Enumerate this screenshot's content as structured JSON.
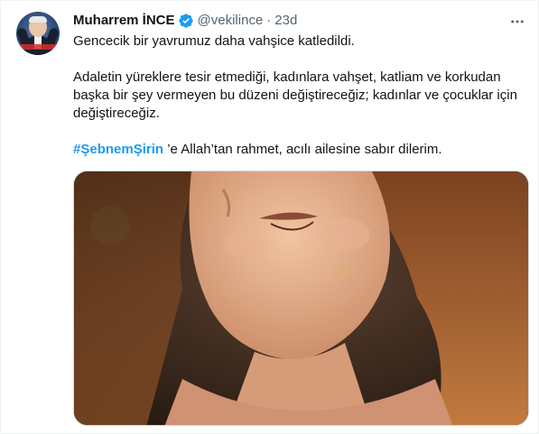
{
  "tweet": {
    "author_name": "Muharrem İNCE",
    "handle": "@vekilince",
    "separator": "·",
    "time": "23d",
    "verified_icon": "verified-badge-icon",
    "more_icon": "more-horizontal-icon",
    "paragraph_1": "Gencecik bir yavrumuz daha vahşice katledildi.",
    "paragraph_2": "Adaletin yüreklere tesir etmediği, kadınlara vahşet, katliam ve korkudan başka bir şey vermeyen bu düzeni değiştireceğiz; kadınlar ve çocuklar için değiştireceğiz.",
    "hashtag": "#ŞebnemŞirin",
    "paragraph_3_rest": " ’e Allah’tan rahmet, acılı ailesine sabır dilerim.",
    "link_color": "#1d9bf0",
    "verified_color": "#1d9bf0"
  }
}
